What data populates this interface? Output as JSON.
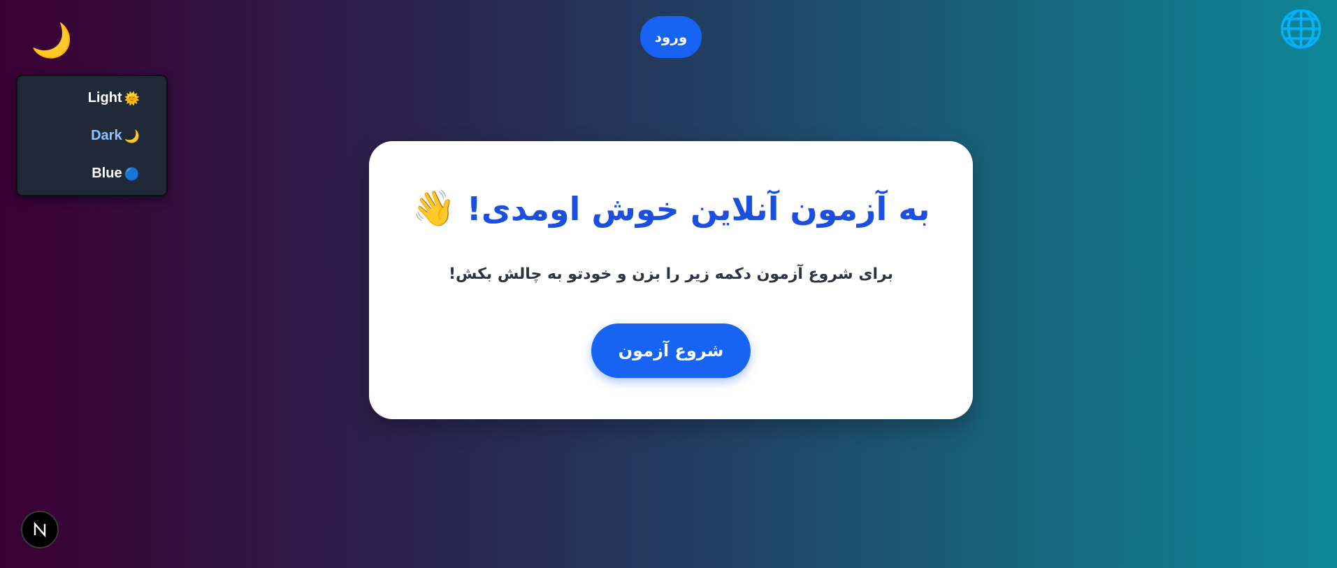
{
  "header": {
    "theme_toggle_icon": "🌙",
    "login_label": "ورود",
    "language_icon": "🌐"
  },
  "theme_menu": {
    "items": [
      {
        "label": "Light",
        "icon": "🌞",
        "icon_name": "sun-icon",
        "active": false
      },
      {
        "label": "Dark",
        "icon": "🌙",
        "icon_name": "moon-icon",
        "active": true
      },
      {
        "label": "Blue",
        "icon": "🔵",
        "icon_name": "blue-circle-icon",
        "active": false
      }
    ]
  },
  "card": {
    "title": "به آزمون آنلاین خوش اومدی!",
    "title_emoji": "👋",
    "subtitle": "برای شروع آزمون دکمه زیر را بزن و خودتو به چالش بکش!",
    "start_label": "شروع آزمون"
  },
  "dev_badge": {
    "letter": "N"
  },
  "colors": {
    "accent": "#1763f3",
    "title": "#1a4fe0",
    "active_item": "#8ec5ff",
    "menu_bg": "#1f2937"
  }
}
